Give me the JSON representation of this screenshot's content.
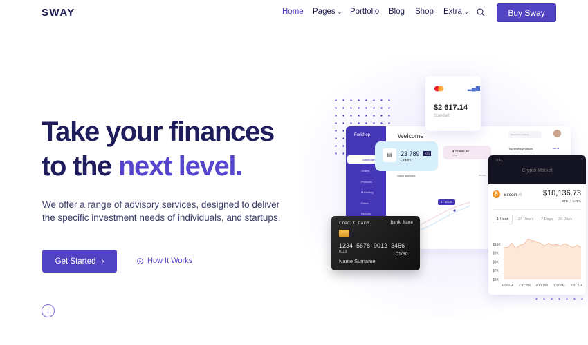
{
  "header": {
    "logo": "SWAY",
    "nav": [
      {
        "label": "Home",
        "active": true
      },
      {
        "label": "Pages",
        "dropdown": true
      },
      {
        "label": "Portfolio"
      },
      {
        "label": "Blog"
      },
      {
        "label": "Shop"
      },
      {
        "label": "Extra",
        "dropdown": true
      }
    ],
    "search_icon": "search-icon",
    "buy_label": "Buy Sway"
  },
  "hero": {
    "title_part1": "Take your finances",
    "title_part2": "to the ",
    "title_highlight": "next level.",
    "lead": "We offer a range of advisory services, designed to deliver the specific investment needs of individuals, and startups.",
    "cta_label": "Get Started",
    "secondary_label": "How It Works",
    "accent": "#5243c2",
    "heading_color": "#1f1d5c"
  },
  "illustration": {
    "mastercard": {
      "amount": "$2 617.14",
      "plan": "Standart"
    },
    "dashboard": {
      "brand": "ForShop",
      "welcome": "Welcome",
      "search_placeholder": "Search for products...",
      "menu": [
        "Dashboard",
        "Orders",
        "Products",
        "Marketing",
        "Rates",
        "Reports"
      ],
      "orders_value": "23 789",
      "orders_badge": "+20",
      "orders_label": "Orders",
      "profit_value": "$ 12 890,89",
      "profit_label": "Profit",
      "sales_title": "Sales statistics",
      "period": "Monthly",
      "tooltip": "$ 7 320,89",
      "top_selling": "Top selling products",
      "see_all": "See all"
    },
    "credit_card": {
      "title": "Credit Card",
      "bank": "Bank Name",
      "number": "1234  5678  9012  3456",
      "small": "0123",
      "expiry": "01/80",
      "holder": "Name Surname"
    },
    "phone": {
      "time": "9:41",
      "title": "Crypto Market",
      "coin": "Bitcoin ☆",
      "price": "$10,136.73",
      "ticker": "BTC",
      "change": "+ 4,72%",
      "tabs": [
        "1 Hour",
        "24 Hours",
        "7 Days",
        "30 Days"
      ],
      "y_labels": [
        "$10K",
        "$9K",
        "$8K",
        "$7K",
        "$6K"
      ],
      "x_labels": [
        "9:13 AM",
        "2:37 PM",
        "8:01 PM",
        "1:17 AM",
        "6:41 AM"
      ],
      "series": [
        9.6,
        9.65,
        10.1,
        9.5,
        9.9,
        10.0,
        10.6,
        10.4,
        10.3,
        10.1,
        9.8,
        10.1,
        9.9,
        9.95,
        9.8,
        10.05,
        9.85,
        9.6,
        9.9,
        9.65
      ],
      "ylim": [
        6,
        11
      ]
    }
  }
}
